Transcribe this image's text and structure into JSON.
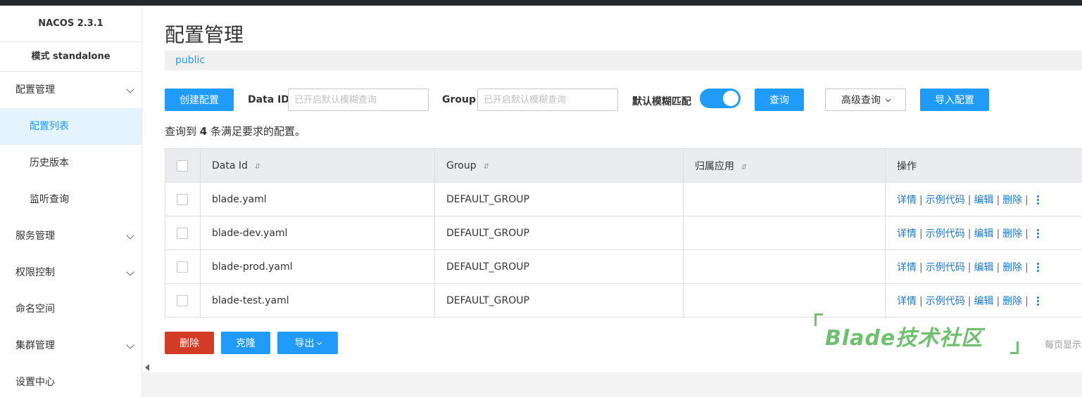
{
  "sidebar": {
    "version": "NACOS 2.3.1",
    "mode": "模式 standalone",
    "items": [
      {
        "label": "配置管理",
        "expandable": true
      },
      {
        "label": "配置列表",
        "sub": true,
        "active": true
      },
      {
        "label": "历史版本",
        "sub": true
      },
      {
        "label": "监听查询",
        "sub": true
      },
      {
        "label": "服务管理",
        "expandable": true
      },
      {
        "label": "权限控制",
        "expandable": true
      },
      {
        "label": "命名空间"
      },
      {
        "label": "集群管理",
        "expandable": true
      },
      {
        "label": "设置中心"
      }
    ]
  },
  "page": {
    "title": "配置管理",
    "namespace": "public"
  },
  "toolbar": {
    "create_label": "创建配置",
    "dataid_label": "Data ID",
    "dataid_placeholder": "已开启默认模糊查询",
    "group_label": "Group",
    "group_placeholder": "已开启默认模糊查询",
    "fuzzy_label": "默认模糊匹配",
    "fuzzy_on": true,
    "query_label": "查询",
    "advanced_label": "高级查询",
    "import_label": "导入配置"
  },
  "summary": {
    "prefix": "查询到",
    "count": "4",
    "suffix": "条满足要求的配置。"
  },
  "table": {
    "headers": [
      "Data Id",
      "Group",
      "归属应用",
      "操作"
    ],
    "actions": [
      "详情",
      "示例代码",
      "编辑",
      "删除"
    ],
    "rows": [
      {
        "data_id": "blade.yaml",
        "group": "DEFAULT_GROUP",
        "app": ""
      },
      {
        "data_id": "blade-dev.yaml",
        "group": "DEFAULT_GROUP",
        "app": ""
      },
      {
        "data_id": "blade-prod.yaml",
        "group": "DEFAULT_GROUP",
        "app": ""
      },
      {
        "data_id": "blade-test.yaml",
        "group": "DEFAULT_GROUP",
        "app": ""
      }
    ]
  },
  "footer": {
    "delete_label": "删除",
    "clone_label": "克隆",
    "export_label": "导出",
    "page_size_label": "每页显示"
  },
  "watermark": {
    "text": "Blade技术社区"
  },
  "colors": {
    "primary": "#209bfa",
    "danger": "#d23c26",
    "link": "#1878c9",
    "watermark": "#6fbf6f"
  }
}
